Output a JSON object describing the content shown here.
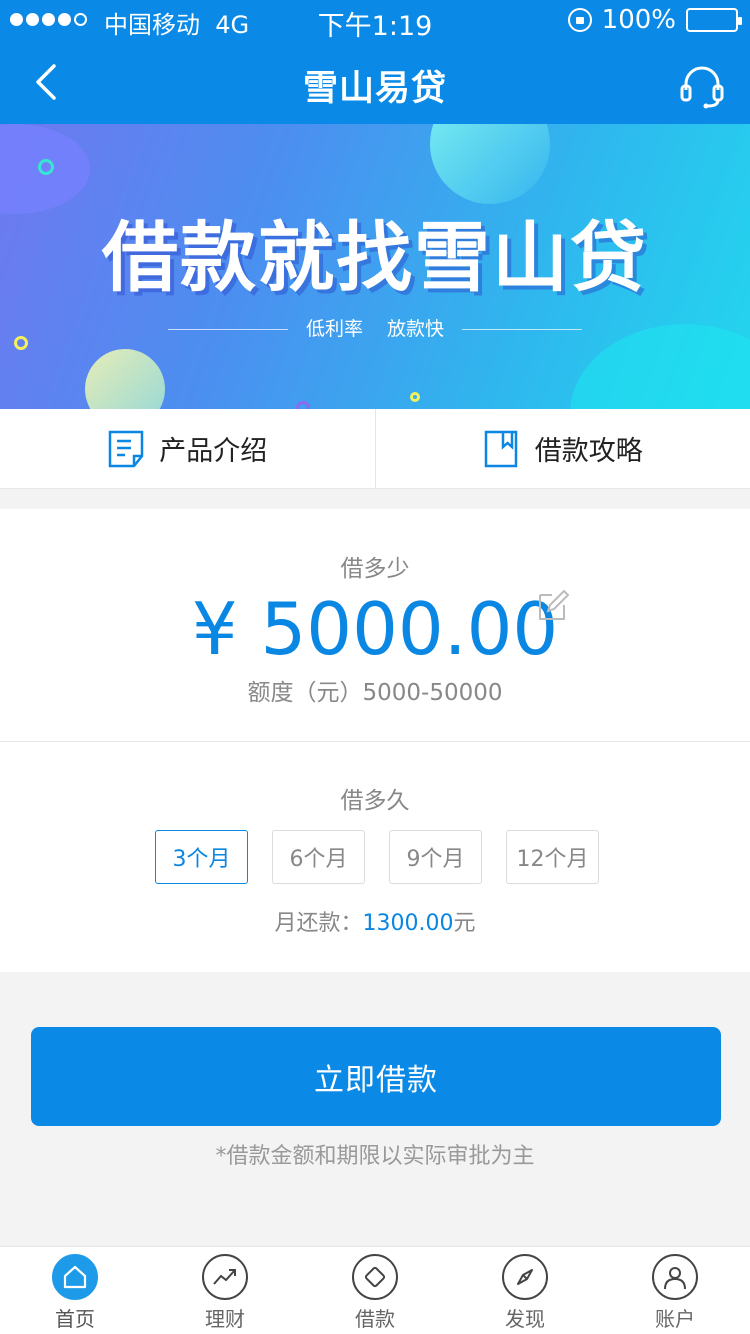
{
  "status_bar": {
    "carrier": "中国移动",
    "network": "4G",
    "time": "下午1:19",
    "battery": "100%"
  },
  "nav": {
    "title": "雪山易贷",
    "back_icon": "chevron-left-icon",
    "support_icon": "headset-icon"
  },
  "banner": {
    "title": "借款就找雪山贷",
    "subtitle_1": "低利率",
    "subtitle_2": "放款快"
  },
  "quick_links": [
    {
      "label": "产品介绍",
      "icon": "document-icon"
    },
    {
      "label": "借款攻略",
      "icon": "bookmark-icon"
    }
  ],
  "loan": {
    "amount_label": "借多少",
    "amount": "¥ 5000.00",
    "range": "额度（元）5000-50000",
    "term_label": "借多久",
    "terms": [
      "3个月",
      "6个月",
      "9个月",
      "12个月"
    ],
    "selected_term": "3个月",
    "monthly_prefix": "月还款：",
    "monthly_value": "1300.00",
    "monthly_suffix": "元"
  },
  "cta": {
    "label": "立即借款",
    "note": "*借款金额和期限以实际审批为主"
  },
  "tabbar": [
    {
      "label": "首页",
      "icon": "home-icon",
      "active": true
    },
    {
      "label": "理财",
      "icon": "chart-trend-icon",
      "active": false
    },
    {
      "label": "借款",
      "icon": "diamond-icon",
      "active": false
    },
    {
      "label": "发现",
      "icon": "compass-icon",
      "active": false
    },
    {
      "label": "账户",
      "icon": "user-icon",
      "active": false
    }
  ],
  "colors": {
    "primary": "#0a8ae6",
    "accent_text": "#0a86e3",
    "background": "#f3f3f3"
  }
}
